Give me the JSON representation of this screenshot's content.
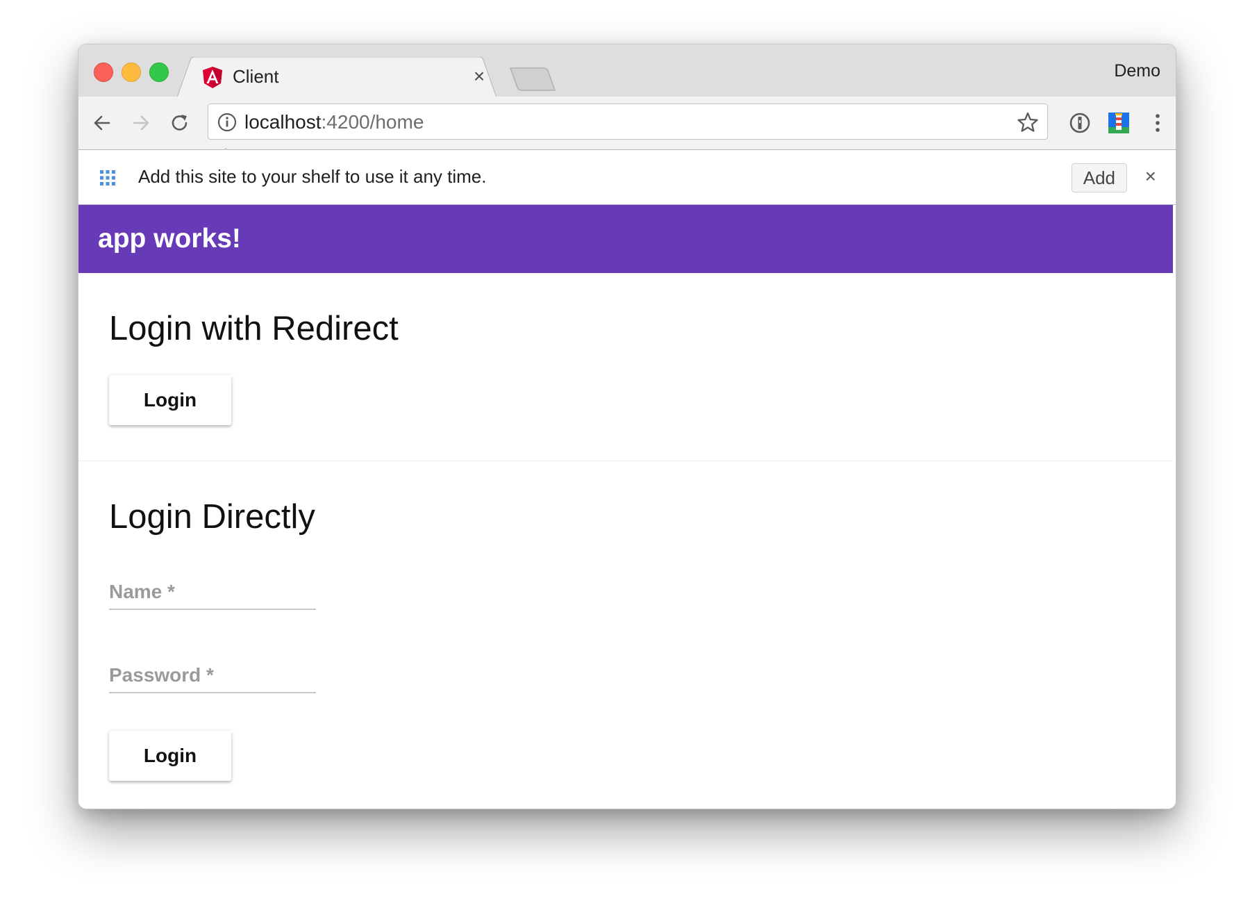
{
  "browser": {
    "tab": {
      "title": "Client",
      "favicon": "angular-icon",
      "close_glyph": "×"
    },
    "profile_name": "Demo",
    "url": {
      "host": "localhost",
      "rest": ":4200/home"
    },
    "infobar": {
      "message": "Add this site to your shelf to use it any time.",
      "add_label": "Add",
      "close_glyph": "×"
    }
  },
  "app": {
    "toolbar_title": "app works!",
    "toolbar_color": "#673ab7",
    "redirect_section": {
      "heading": "Login with Redirect",
      "login_label": "Login"
    },
    "direct_section": {
      "heading": "Login Directly",
      "name_label": "Name *",
      "password_label": "Password *",
      "login_label": "Login"
    }
  }
}
